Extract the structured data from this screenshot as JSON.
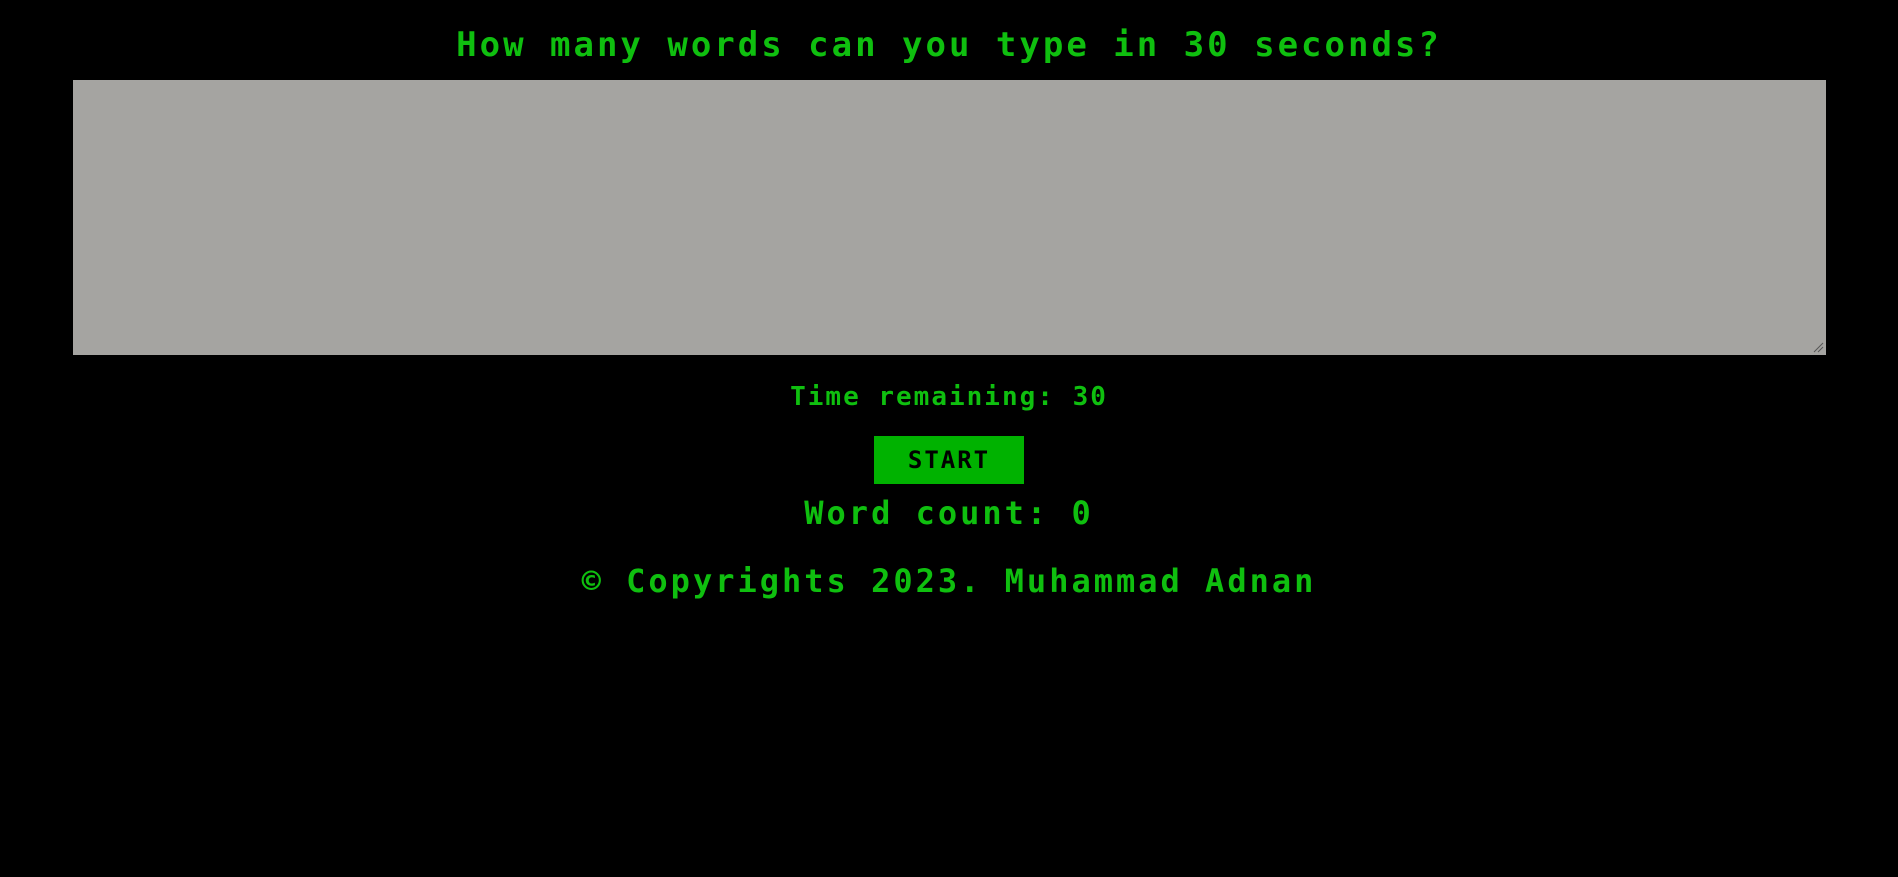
{
  "header": {
    "title": "How many words can you type in 30 seconds?"
  },
  "typing_area": {
    "value": "",
    "placeholder": ""
  },
  "timer": {
    "text": "Time remaining: 30"
  },
  "controls": {
    "start_label": "START"
  },
  "stats": {
    "word_count_text": "Word count: 0"
  },
  "footer": {
    "copyright_text": "© Copyrights 2023. Muhammad Adnan"
  },
  "colors": {
    "background": "#000000",
    "text_green": "#0fbf0f",
    "button_green": "#00b200",
    "textarea_gray": "#a5a4a1"
  },
  "icons": {
    "resize_grip": "resize-grip-icon"
  }
}
